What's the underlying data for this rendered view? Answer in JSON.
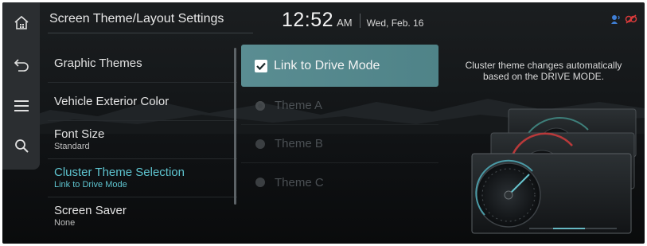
{
  "header": {
    "title": "Screen Theme/Layout Settings",
    "time": "12:52",
    "ampm": "AM",
    "date": "Wed, Feb. 16"
  },
  "rail": {
    "icons": [
      "home-icon",
      "back-icon",
      "menu-icon",
      "search-icon"
    ]
  },
  "status": {
    "icons": [
      "voice-recognition-icon",
      "connectivity-off-icon"
    ],
    "icon_colors": {
      "voice": "#3f7fd6",
      "off": "#d83a3a"
    }
  },
  "menu": {
    "items": [
      {
        "label": "Graphic Themes",
        "sub": ""
      },
      {
        "label": "Vehicle Exterior Color",
        "sub": ""
      },
      {
        "label": "Font Size",
        "sub": "Standard"
      },
      {
        "label": "Cluster Theme Selection",
        "sub": "Link to Drive Mode"
      },
      {
        "label": "Screen Saver",
        "sub": "None"
      }
    ],
    "active_index": 3
  },
  "options": {
    "link": {
      "label": "Link to Drive Mode",
      "checked": true
    },
    "themes": [
      {
        "label": "Theme A",
        "selected": true,
        "enabled": false
      },
      {
        "label": "Theme B",
        "selected": false,
        "enabled": false
      },
      {
        "label": "Theme C",
        "selected": false,
        "enabled": false
      }
    ]
  },
  "info": {
    "description_line1": "Cluster theme changes automatically",
    "description_line2": "based on the DRIVE MODE."
  },
  "colors": {
    "accent": "#5ec4cf",
    "highlight": "#5a8d92",
    "background": "#15181a",
    "rail": "#2b2e31"
  }
}
